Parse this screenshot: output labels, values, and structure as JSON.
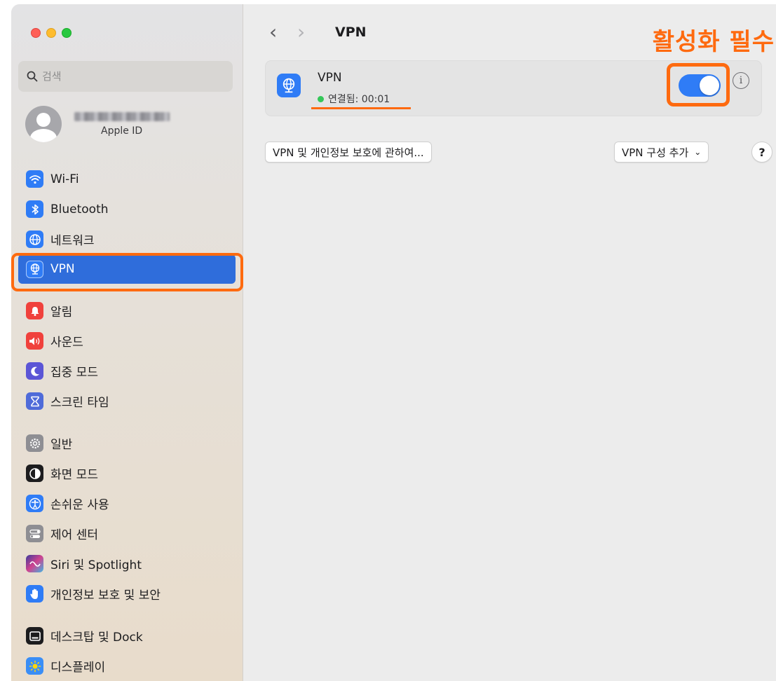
{
  "annotation": {
    "text": "활성화 필수",
    "color": "#fe6a0f"
  },
  "window": {
    "traffic_lights": [
      "close",
      "minimize",
      "zoom"
    ]
  },
  "sidebar": {
    "search": {
      "placeholder": "검색",
      "value": ""
    },
    "account": {
      "subtitle": "Apple ID"
    },
    "items": [
      {
        "label": "Wi-Fi",
        "icon": "wifi-icon",
        "color": "#2f7cf6"
      },
      {
        "label": "Bluetooth",
        "icon": "bluetooth-icon",
        "color": "#2f7cf6"
      },
      {
        "label": "네트워크",
        "icon": "globe-icon",
        "color": "#2f7cf6"
      },
      {
        "label": "VPN",
        "icon": "vpn-globe-icon",
        "color": "#2f7cf6",
        "selected": true
      },
      {
        "label": "알림",
        "icon": "bell-icon",
        "color": "#f0413c"
      },
      {
        "label": "사운드",
        "icon": "speaker-icon",
        "color": "#f0413c"
      },
      {
        "label": "집중 모드",
        "icon": "moon-icon",
        "color": "#5b55d6"
      },
      {
        "label": "스크린 타임",
        "icon": "hourglass-icon",
        "color": "#5b55d6"
      },
      {
        "label": "일반",
        "icon": "gear-icon",
        "color": "#8e8e93"
      },
      {
        "label": "화면 모드",
        "icon": "appearance-icon",
        "color": "#1c1c1e"
      },
      {
        "label": "손쉬운 사용",
        "icon": "accessibility-icon",
        "color": "#2f7cf6"
      },
      {
        "label": "제어 센터",
        "icon": "switches-icon",
        "color": "#8e8e93"
      },
      {
        "label": "Siri 및 Spotlight",
        "icon": "siri-icon",
        "color": "#6a4bd1"
      },
      {
        "label": "개인정보 보호 및 보안",
        "icon": "hand-icon",
        "color": "#2f7cf6"
      },
      {
        "label": "데스크탑 및 Dock",
        "icon": "dock-icon",
        "color": "#1c1c1e"
      },
      {
        "label": "디스플레이",
        "icon": "sun-icon",
        "color": "#2f7cf6"
      }
    ]
  },
  "main": {
    "title": "VPN",
    "vpn": {
      "name": "VPN",
      "status": "연결됨: 00:01",
      "enabled": true
    },
    "about_button": "VPN 및 개인정보 보호에 관하여...",
    "add_config_button": "VPN 구성 추가",
    "help_button": "?",
    "info_icon": "i"
  }
}
